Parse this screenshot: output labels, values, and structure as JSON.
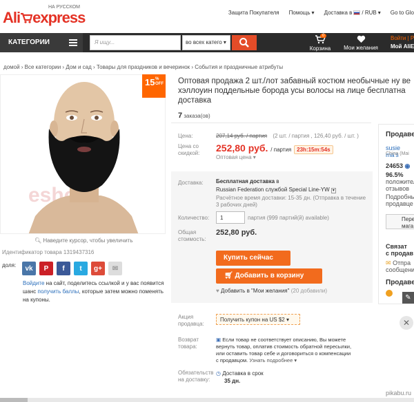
{
  "header": {
    "logo_sub": "НА РУССКОМ",
    "logo_ali": "Ali",
    "logo_express": "express",
    "links": [
      "Защита Покупателя",
      "Помощь",
      "Доставка в",
      "/ RUB",
      "Go to Glo"
    ]
  },
  "nav": {
    "categories_label": "КАТЕГОРИИ",
    "search_placeholder": "Я ищу...",
    "search_category": "во всех катего",
    "cart_label": "Корзина",
    "cart_count": "0",
    "wishlist_label": "Мои желания",
    "login_top": "Войти | Ре",
    "login_bottom": "Мой AliE"
  },
  "breadcrumb": "домой › Все категории › Дом и сад › Товары для праздников и вечеринок › События и праздничные атрибуты",
  "gallery": {
    "discount": "15",
    "discount_pct": "%",
    "discount_off": "OFF",
    "watermark": "eshore",
    "zoom_hint": "Наведите курсор, чтобы увеличить",
    "product_id": "Идентификатор товара 1319437316",
    "share_label": "доля:",
    "promo_link1": "Войдите",
    "promo_text1": " на сайт, поделитесь ссылкой и у вас появится шанс ",
    "promo_link2": "получить баллы",
    "promo_text2": ", которые затем можно поменять на купоны."
  },
  "product": {
    "title_line1": "Оптовая продажа 2 шт./лот забавный костюм необычные ну ве",
    "title_line2": "хэллоуин поддельные борода усы волосы на лице бесплатна",
    "title_line3": "доставка",
    "orders_count": "7",
    "orders_label": " заказа(ов)",
    "price_label": "Цена:",
    "old_price": "207,14 руб. / партия",
    "old_price_detail": "(2 шт. / партия , 126,40 руб. / шт. )",
    "discount_label_1": "Цена со",
    "discount_label_2": "скидкой:",
    "price": "252,80 руб.",
    "price_unit": "/ партия",
    "timer": "23h:15m:54s",
    "wholesale": "Оптовая цена",
    "shipping_label": "Доставка:",
    "shipping_free": "Бесплатная доставка",
    "shipping_in": " в",
    "shipping_service": "Russian Federation службой Special Line-YW",
    "shipping_time": "Расчётное время доставки: 15-35 дн. (Отправка в течение",
    "shipping_time2": "3 рабочих дней)",
    "qty_label": "Количество:",
    "qty_value": "1",
    "qty_available": "партия (999 партий(й) available)",
    "total_label_1": "Общая",
    "total_label_2": "стоимость:",
    "total": "252,80 руб.",
    "buy_now": "Купить сейчас",
    "add_to_cart": "Добавить в корзину",
    "wishlist_add": "Добавить в \"Мои желания\"",
    "wishlist_count": "(20 добавили)",
    "promo_label_1": "Акция",
    "promo_label_2": "продавца:",
    "coupon": "Получить купон на US $2",
    "return_label_1": "Возврат",
    "return_label_2": "товара:",
    "return_text1": "Если товар не соответствует описанию, Вы можете",
    "return_text2": "вернуть товар, оплатив стоимость обратной пересылки,",
    "return_text3": "или оставить товар себе и договориться о компенсации",
    "return_text4": "с продавцом. ",
    "return_more": "Узнать подробнее",
    "guarantee_label_1": "Обязательств",
    "guarantee_label_2": "на доставку:",
    "guarantee_text": "Доставка в срок",
    "guarantee_days": "35 дн."
  },
  "seller": {
    "heading": "Продаве",
    "name": "susie ma's",
    "country": "China (Mai",
    "score": "24653",
    "positive": "96.5%",
    "positive_label_1": "положител",
    "positive_label_2": "отзывов",
    "details_1": "Подробны",
    "details_2": "продавце",
    "contact_btn_1": "Пере",
    "contact_btn_2": "мага",
    "contact_heading_1": "Связат",
    "contact_heading_2": "с продав",
    "contact_msg_1": "Отпра",
    "contact_msg_2": "сообщение",
    "heading2": "Продаве"
  },
  "footer": {
    "watermark": "pikabu.ru"
  },
  "colors": {
    "accent": "#e43225",
    "button": "#f26b1d",
    "link": "#2a6ebb"
  }
}
